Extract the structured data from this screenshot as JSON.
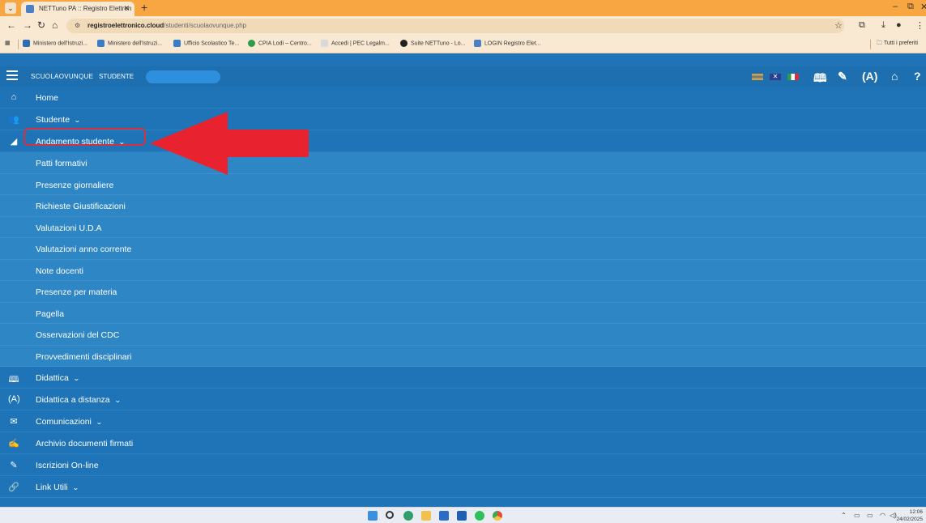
{
  "browser": {
    "tab_title": "NETTuno PA :: Registro Elettron",
    "url_host": "registroelettronico.cloud",
    "url_path": "/studenti/scuolaovunque.php",
    "bookmarks": [
      {
        "label": "Ministero dell'Istruzi...",
        "color": "#2f6db5"
      },
      {
        "label": "Ministero dell'Istruzi...",
        "color": "#3b7dc4"
      },
      {
        "label": "Ufficio Scolastico Te...",
        "color": "#3b7dc4"
      },
      {
        "label": "CPIA Lodi – Centro...",
        "color": "#2e9b4a"
      },
      {
        "label": "Accedi | PEC Legalm...",
        "color": "#d9d9d9"
      },
      {
        "label": "Suite NETTuno - Lo...",
        "color": "#222222"
      },
      {
        "label": "LOGIN Registro Elet...",
        "color": "#4d7fc4"
      }
    ],
    "all_bookmarks": "Tutti i preferiti"
  },
  "app": {
    "brand": "SCUOLAOVUNQUE",
    "role": "STUDENTE"
  },
  "menu": {
    "home": "Home",
    "studente": "Studente",
    "andamento": "Andamento studente",
    "submenu": [
      "Patti formativi",
      "Presenze giornaliere",
      "Richieste Giustificazioni",
      "Valutazioni U.D.A",
      "Valutazioni anno corrente",
      "Note docenti",
      "Presenze per materia",
      "Pagella",
      "Osservazioni del CDC",
      "Provvedimenti disciplinari"
    ],
    "didattica": "Didattica",
    "didattica_distanza": "Didattica a distanza",
    "comunicazioni": "Comunicazioni",
    "archivio": "Archivio documenti firmati",
    "iscrizioni": "Iscrizioni On-line",
    "link_utili": "Link Utili"
  },
  "taskbar": {
    "time": "12:06",
    "date": "24/02/2025"
  },
  "colors": {
    "accent": "#1e74b6",
    "submenu_bg": "#2f86c5",
    "highlight": "#d9303f"
  }
}
